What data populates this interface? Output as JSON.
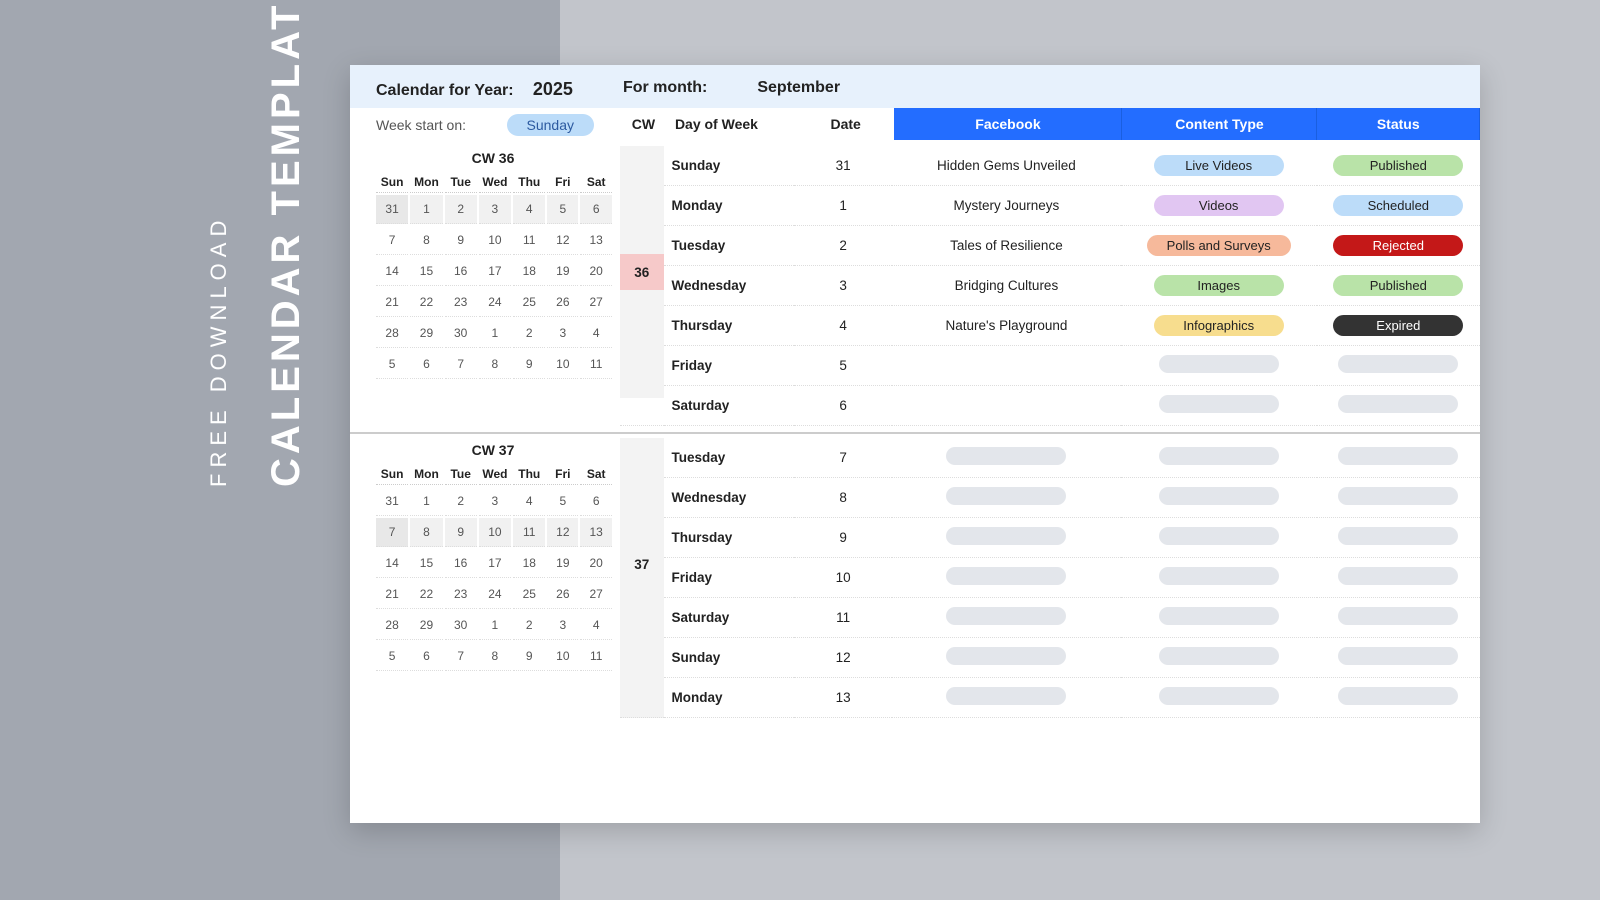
{
  "promo": {
    "line1": "FREE DOWNLOAD",
    "line2": "CALENDAR TEMPLATE"
  },
  "header": {
    "label_year": "Calendar for Year:",
    "year": "2025",
    "label_month": "For month:",
    "month": "September",
    "week_start_label": "Week start on:",
    "week_start_value": "Sunday"
  },
  "cols": {
    "cw": "CW",
    "dow": "Day of Week",
    "date": "Date",
    "platform": "Facebook",
    "ctype": "Content Type",
    "status": "Status"
  },
  "mini_headers": [
    "Sun",
    "Mon",
    "Tue",
    "Wed",
    "Thu",
    "Fri",
    "Sat"
  ],
  "cw36": {
    "label": "CW  36",
    "mini": [
      [
        "31",
        "1",
        "2",
        "3",
        "4",
        "5",
        "6"
      ],
      [
        "7",
        "8",
        "9",
        "10",
        "11",
        "12",
        "13"
      ],
      [
        "14",
        "15",
        "16",
        "17",
        "18",
        "19",
        "20"
      ],
      [
        "21",
        "22",
        "23",
        "24",
        "25",
        "26",
        "27"
      ],
      [
        "28",
        "29",
        "30",
        "1",
        "2",
        "3",
        "4"
      ],
      [
        "5",
        "6",
        "7",
        "8",
        "9",
        "10",
        "11"
      ]
    ],
    "cw_num": "36",
    "rows": [
      {
        "dow": "Sunday",
        "date": "31",
        "fb": "Hidden Gems Unveiled",
        "ct": "Live Videos",
        "ctc": "live",
        "st": "Published",
        "stc": "pub"
      },
      {
        "dow": "Monday",
        "date": "1",
        "fb": "Mystery Journeys",
        "ct": "Videos",
        "ctc": "vid",
        "st": "Scheduled",
        "stc": "sch"
      },
      {
        "dow": "Tuesday",
        "date": "2",
        "fb": "Tales of Resilience",
        "ct": "Polls and Surveys",
        "ctc": "poll",
        "st": "Rejected",
        "stc": "rej"
      },
      {
        "dow": "Wednesday",
        "date": "3",
        "fb": "Bridging Cultures",
        "ct": "Images",
        "ctc": "img",
        "st": "Published",
        "stc": "pub"
      },
      {
        "dow": "Thursday",
        "date": "4",
        "fb": "Nature's Playground",
        "ct": "Infographics",
        "ctc": "info",
        "st": "Expired",
        "stc": "exp"
      },
      {
        "dow": "Friday",
        "date": "5",
        "fb": "",
        "ct": "",
        "ctc": "empty",
        "st": "",
        "stc": "empty"
      },
      {
        "dow": "Saturday",
        "date": "6",
        "fb": "",
        "ct": "",
        "ctc": "empty",
        "st": "",
        "stc": "empty"
      }
    ]
  },
  "cw37": {
    "label": "CW  37",
    "cw_num": "37",
    "mini": [
      [
        "31",
        "1",
        "2",
        "3",
        "4",
        "5",
        "6"
      ],
      [
        "7",
        "8",
        "9",
        "10",
        "11",
        "12",
        "13"
      ],
      [
        "14",
        "15",
        "16",
        "17",
        "18",
        "19",
        "20"
      ],
      [
        "21",
        "22",
        "23",
        "24",
        "25",
        "26",
        "27"
      ],
      [
        "28",
        "29",
        "30",
        "1",
        "2",
        "3",
        "4"
      ],
      [
        "5",
        "6",
        "7",
        "8",
        "9",
        "10",
        "11"
      ]
    ],
    "rows": [
      {
        "dow": "Tuesday",
        "date": "7"
      },
      {
        "dow": "Wednesday",
        "date": "8"
      },
      {
        "dow": "Thursday",
        "date": "9"
      },
      {
        "dow": "Friday",
        "date": "10"
      },
      {
        "dow": "Saturday",
        "date": "11"
      },
      {
        "dow": "Sunday",
        "date": "12"
      },
      {
        "dow": "Monday",
        "date": "13"
      }
    ]
  }
}
